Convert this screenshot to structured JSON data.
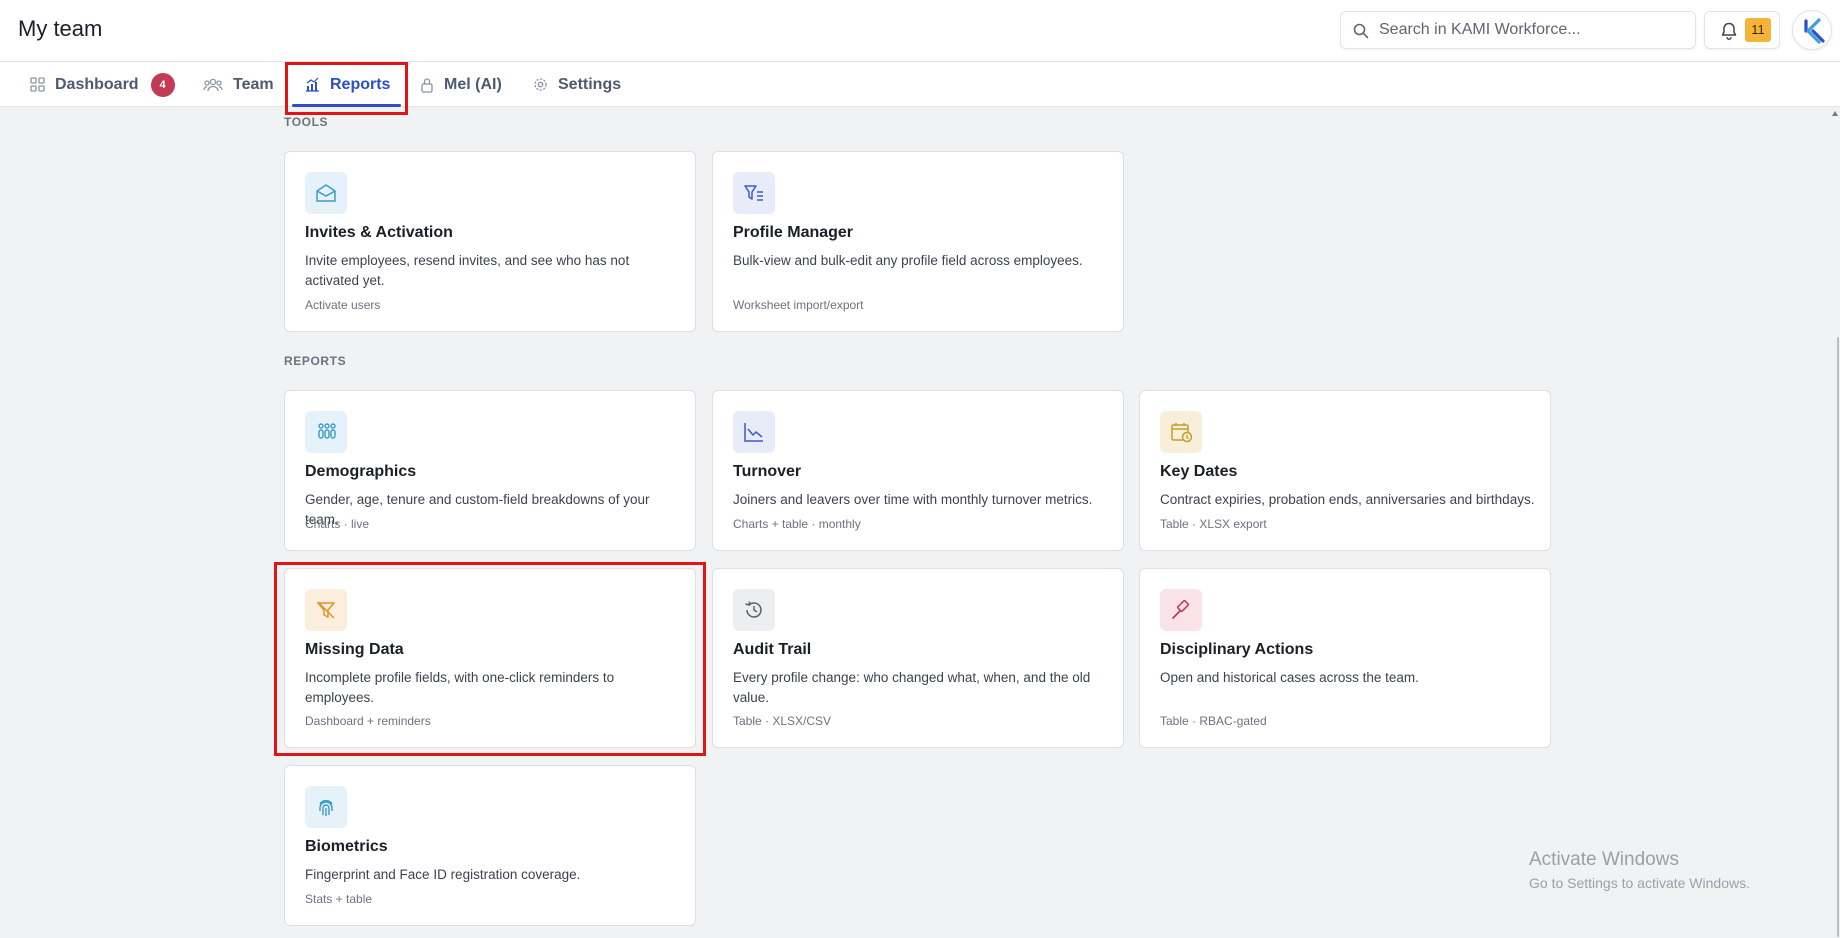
{
  "header": {
    "title": "My team",
    "search_placeholder": "Search in KAMI Workforce...",
    "notifications_count": "11"
  },
  "tabs": [
    {
      "label": "Dashboard",
      "badge": "4"
    },
    {
      "label": "Team"
    },
    {
      "label": "Reports",
      "active": true
    },
    {
      "label": "Mel (AI)"
    },
    {
      "label": "Settings"
    }
  ],
  "sections": {
    "tools_label": "TOOLS",
    "reports_label": "REPORTS"
  },
  "tools": [
    {
      "title": "Invites & Activation",
      "description": "Invite employees, resend invites, and see who has not activated yet.",
      "meta": "Activate users",
      "icon": "envelope-open-icon"
    },
    {
      "title": "Profile Manager",
      "description": "Bulk-view and bulk-edit any profile field across employees.",
      "meta": "Worksheet import/export",
      "icon": "filter-list-icon"
    }
  ],
  "reports": [
    {
      "title": "Demographics",
      "description": "Gender, age, tenure and custom-field breakdowns of your team.",
      "meta": "Charts · live",
      "icon": "people-group-icon"
    },
    {
      "title": "Turnover",
      "description": "Joiners and leavers over time with monthly turnover metrics.",
      "meta": "Charts + table · monthly",
      "icon": "trend-chart-icon"
    },
    {
      "title": "Key Dates",
      "description": "Contract expiries, probation ends, anniversaries and birthdays.",
      "meta": "Table · XLSX export",
      "icon": "calendar-clock-icon"
    },
    {
      "title": "Missing Data",
      "description": "Incomplete profile fields, with one-click reminders to employees.",
      "meta": "Dashboard + reminders",
      "icon": "filter-off-icon"
    },
    {
      "title": "Audit Trail",
      "description": "Every profile change: who changed what, when, and the old value.",
      "meta": "Table · XLSX/CSV",
      "icon": "history-icon"
    },
    {
      "title": "Disciplinary Actions",
      "description": "Open and historical cases across the team.",
      "meta": "Table · RBAC-gated",
      "icon": "gavel-icon"
    },
    {
      "title": "Biometrics",
      "description": "Fingerprint and Face ID registration coverage.",
      "meta": "Stats + table",
      "icon": "fingerprint-icon"
    }
  ],
  "watermark": {
    "line1": "Activate Windows",
    "line2": "Go to Settings to activate Windows."
  },
  "colors": {
    "accent": "#2c4ec7",
    "badge": "#c23a55",
    "notification": "#f6b33a",
    "highlight": "#e01616"
  }
}
